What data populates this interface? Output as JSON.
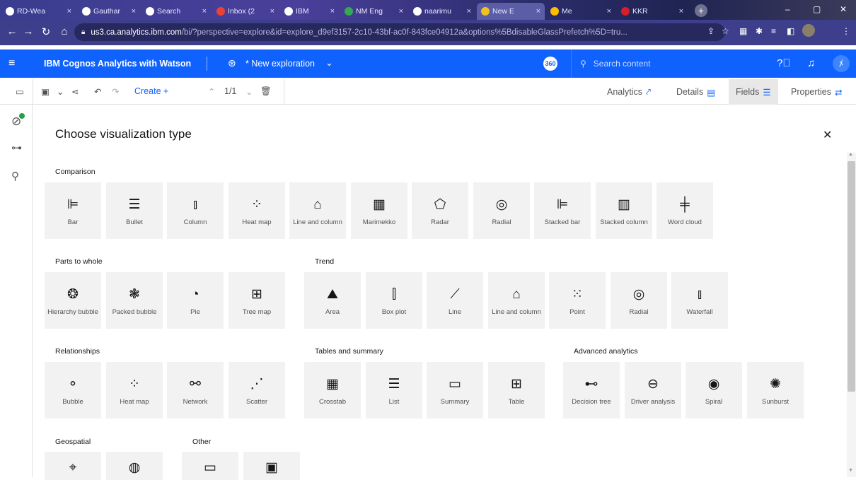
{
  "browser": {
    "tabs": [
      {
        "label": "RD-Wea",
        "fav": "github-icon",
        "color": "#ffffff"
      },
      {
        "label": "Gauthar",
        "fav": "github-icon",
        "color": "#ffffff"
      },
      {
        "label": "Search",
        "fav": "github-icon",
        "color": "#ffffff"
      },
      {
        "label": "Inbox (2",
        "fav": "gmail-icon",
        "color": "#ea4335"
      },
      {
        "label": "IBM",
        "fav": "ibm-icon",
        "color": "#ffffff"
      },
      {
        "label": "NM Eng",
        "fav": "drive-icon",
        "color": "#34a853"
      },
      {
        "label": "naarimu",
        "fav": "github-icon",
        "color": "#ffffff"
      },
      {
        "label": "New E",
        "fav": "cognos-icon",
        "color": "#f1c21b"
      },
      {
        "label": "Me",
        "fav": "google-icon",
        "color": "#fbbc04"
      },
      {
        "label": "KKR",
        "fav": "app-icon",
        "color": "#da1e28"
      }
    ],
    "url_host": "us3.ca.analytics.ibm.com",
    "url_rest": "/bi/?perspective=explore&id=explore_d9ef3157-2c10-43bf-ac0f-843fce04912a&options%5BdisableGlassPrefetch%5D=tru..."
  },
  "app": {
    "brand": "IBM Cognos Analytics with Watson",
    "exploration_title": "* New exploration",
    "badge": "360",
    "search_placeholder": "Search content"
  },
  "toolbar": {
    "create_label": "Create",
    "create_plus": "+",
    "page_indicator": "1/1",
    "right_tabs": [
      {
        "label": "Analytics",
        "icon": "analytics-icon",
        "glyph": "⤤"
      },
      {
        "label": "Details",
        "icon": "details-icon",
        "glyph": "▤"
      },
      {
        "label": "Fields",
        "icon": "fields-icon",
        "glyph": "☰"
      },
      {
        "label": "Properties",
        "icon": "properties-icon",
        "glyph": "⇄"
      }
    ]
  },
  "panel": {
    "title": "Choose visualization type",
    "sections": [
      {
        "title": "Comparison",
        "items": [
          {
            "label": "Bar",
            "icon": "bar-chart-icon",
            "glyph": "⊫"
          },
          {
            "label": "Bullet",
            "icon": "bullet-chart-icon",
            "glyph": "☰"
          },
          {
            "label": "Column",
            "icon": "column-chart-icon",
            "glyph": "⫾"
          },
          {
            "label": "Heat map",
            "icon": "heat-map-icon",
            "glyph": "⁘"
          },
          {
            "label": "Line and column",
            "icon": "line-and-column-icon",
            "glyph": "⌂"
          },
          {
            "label": "Marimekko",
            "icon": "marimekko-icon",
            "glyph": "▦"
          },
          {
            "label": "Radar",
            "icon": "radar-icon",
            "glyph": "⬠"
          },
          {
            "label": "Radial",
            "icon": "radial-icon",
            "glyph": "◎"
          },
          {
            "label": "Stacked bar",
            "icon": "stacked-bar-icon",
            "glyph": "⊫"
          },
          {
            "label": "Stacked column",
            "icon": "stacked-column-icon",
            "glyph": "▥"
          },
          {
            "label": "Word cloud",
            "icon": "word-cloud-icon",
            "glyph": "╪"
          }
        ]
      },
      {
        "title": "Parts to whole",
        "items": [
          {
            "label": "Hierarchy bubble",
            "icon": "hierarchy-bubble-icon",
            "glyph": "❂"
          },
          {
            "label": "Packed bubble",
            "icon": "packed-bubble-icon",
            "glyph": "❃"
          },
          {
            "label": "Pie",
            "icon": "pie-chart-icon",
            "glyph": "◔"
          },
          {
            "label": "Tree map",
            "icon": "tree-map-icon",
            "glyph": "⊞"
          }
        ]
      },
      {
        "title": "Trend",
        "items": [
          {
            "label": "Area",
            "icon": "area-chart-icon",
            "glyph": "⛰"
          },
          {
            "label": "Box plot",
            "icon": "box-plot-icon",
            "glyph": "⫿"
          },
          {
            "label": "Line",
            "icon": "line-chart-icon",
            "glyph": "⟋"
          },
          {
            "label": "Line and column",
            "icon": "line-and-column-icon",
            "glyph": "⌂"
          },
          {
            "label": "Point",
            "icon": "point-chart-icon",
            "glyph": "⁙"
          },
          {
            "label": "Radial",
            "icon": "radial-icon",
            "glyph": "◎"
          },
          {
            "label": "Waterfall",
            "icon": "waterfall-icon",
            "glyph": "⫾"
          }
        ]
      },
      {
        "title": "Relationships",
        "items": [
          {
            "label": "Bubble",
            "icon": "bubble-chart-icon",
            "glyph": "⚬"
          },
          {
            "label": "Heat map",
            "icon": "heat-map-icon",
            "glyph": "⁘"
          },
          {
            "label": "Network",
            "icon": "network-icon",
            "glyph": "⚯"
          },
          {
            "label": "Scatter",
            "icon": "scatter-icon",
            "glyph": "⋰"
          }
        ]
      },
      {
        "title": "Tables and summary",
        "items": [
          {
            "label": "Crosstab",
            "icon": "crosstab-icon",
            "glyph": "▦"
          },
          {
            "label": "List",
            "icon": "list-icon",
            "glyph": "☰"
          },
          {
            "label": "Summary",
            "icon": "summary-icon",
            "glyph": "▭"
          },
          {
            "label": "Table",
            "icon": "table-icon",
            "glyph": "⊞"
          }
        ]
      },
      {
        "title": "Advanced analytics",
        "items": [
          {
            "label": "Decision tree",
            "icon": "decision-tree-icon",
            "glyph": "⊷"
          },
          {
            "label": "Driver analysis",
            "icon": "driver-analysis-icon",
            "glyph": "⊖"
          },
          {
            "label": "Spiral",
            "icon": "spiral-icon",
            "glyph": "◉"
          },
          {
            "label": "Sunburst",
            "icon": "sunburst-icon",
            "glyph": "✺"
          }
        ]
      },
      {
        "title": "Geospatial",
        "items": [
          {
            "label": "",
            "icon": "map-pin-icon",
            "glyph": "⌖"
          },
          {
            "label": "",
            "icon": "globe-icon",
            "glyph": "◍"
          }
        ]
      },
      {
        "title": "Other",
        "items": [
          {
            "label": "",
            "icon": "kpi-icon",
            "glyph": "▭"
          },
          {
            "label": "",
            "icon": "kpi-chart-icon",
            "glyph": "▣"
          }
        ]
      }
    ]
  },
  "colors": {
    "accent": "#0f62fe",
    "card": "#f2f2f2"
  }
}
